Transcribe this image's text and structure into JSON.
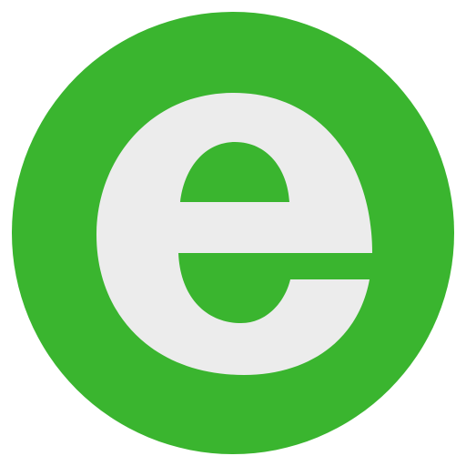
{
  "icon": {
    "name": "e-letter-logo-icon",
    "letter": "e",
    "colors": {
      "circle": "#3ab52f",
      "letter": "#ececec",
      "background": "#ffffff"
    }
  }
}
